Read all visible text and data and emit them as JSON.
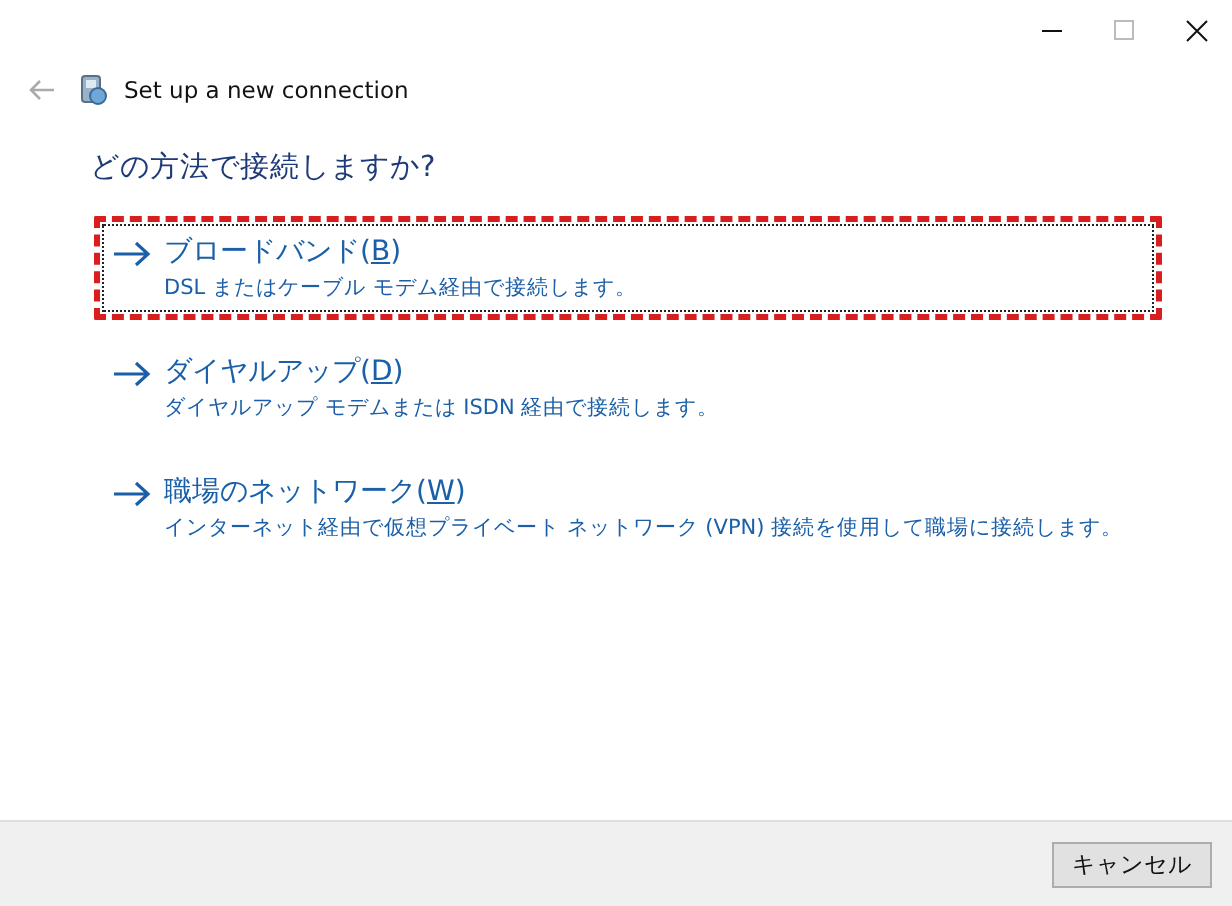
{
  "window": {
    "title": "Set up a new connection"
  },
  "heading": "どの方法で接続しますか?",
  "options": [
    {
      "label_before": "ブロードバンド(",
      "access_key": "B",
      "label_after": ")",
      "description": "DSL またはケーブル モデム経由で接続します。",
      "highlighted": true
    },
    {
      "label_before": "ダイヤルアップ(",
      "access_key": "D",
      "label_after": ")",
      "description": "ダイヤルアップ モデムまたは ISDN 経由で接続します。",
      "highlighted": false
    },
    {
      "label_before": "職場のネットワーク(",
      "access_key": "W",
      "label_after": ")",
      "description": "インターネット経由で仮想プライベート ネットワーク (VPN) 接続を使用して職場に接続します。",
      "highlighted": false
    }
  ],
  "buttons": [
    "キャンセル"
  ]
}
